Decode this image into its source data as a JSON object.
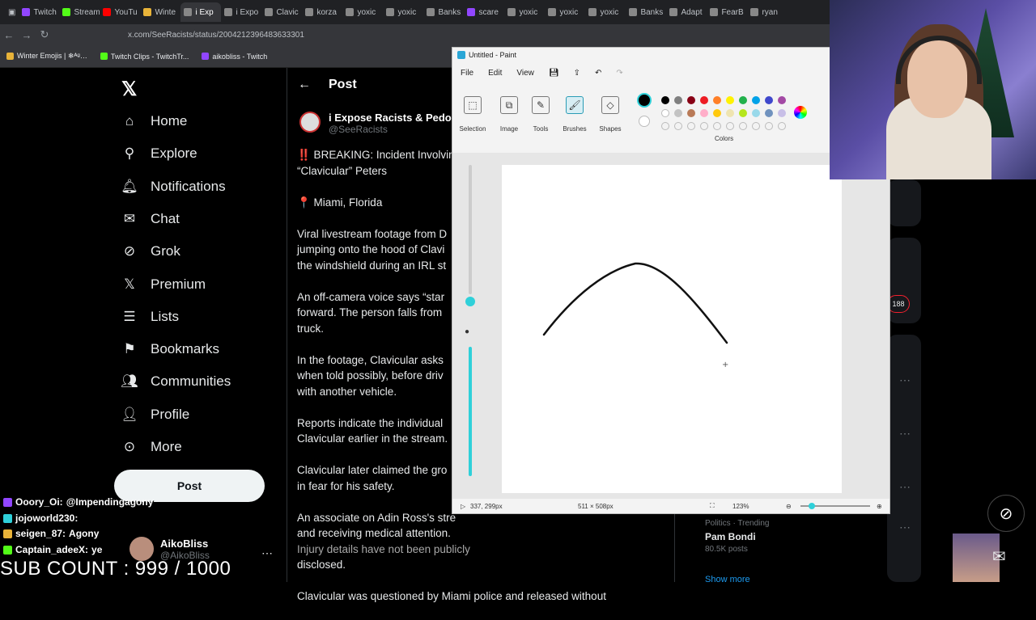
{
  "browser": {
    "tabs": [
      {
        "label": "Twitch",
        "color": "#9146ff"
      },
      {
        "label": "Stream",
        "color": "#53fc18"
      },
      {
        "label": "YouTu",
        "color": "#ff0000"
      },
      {
        "label": "Winte",
        "color": "#e8b339"
      },
      {
        "label": "i Exp",
        "color": "#888888",
        "active": true
      },
      {
        "label": "i Expo",
        "color": "#888888"
      },
      {
        "label": "Clavic",
        "color": "#888888"
      },
      {
        "label": "korza",
        "color": "#888888"
      },
      {
        "label": "yoxic",
        "color": "#888888"
      },
      {
        "label": "yoxic",
        "color": "#888888"
      },
      {
        "label": "Banks",
        "color": "#888888"
      },
      {
        "label": "scare",
        "color": "#9146ff"
      },
      {
        "label": "yoxic",
        "color": "#888888"
      },
      {
        "label": "yoxic",
        "color": "#888888"
      },
      {
        "label": "yoxic",
        "color": "#888888"
      },
      {
        "label": "Banks",
        "color": "#888888"
      },
      {
        "label": "Adapt",
        "color": "#888888"
      },
      {
        "label": "FearB",
        "color": "#888888"
      },
      {
        "label": "ryan",
        "color": "#888888"
      }
    ],
    "url": "x.com/SeeRacists/status/2004212396483633301",
    "bookmarks": [
      {
        "label": "Winter Emojis | ❄ᴬᵍ…",
        "color": "#e8b339"
      },
      {
        "label": "Twitch Clips - TwitchTr...",
        "color": "#53fc18"
      },
      {
        "label": "aikobliss - Twitch",
        "color": "#9146ff"
      }
    ]
  },
  "x": {
    "logo": "𝕏",
    "nav": [
      {
        "label": "Home",
        "icon": "home-icon",
        "glyph": "⌂"
      },
      {
        "label": "Explore",
        "icon": "search-icon",
        "glyph": "⚲"
      },
      {
        "label": "Notifications",
        "icon": "bell-icon",
        "glyph": "🔔︎"
      },
      {
        "label": "Chat",
        "icon": "mail-icon",
        "glyph": "✉"
      },
      {
        "label": "Grok",
        "icon": "grok-icon",
        "glyph": "⊘"
      },
      {
        "label": "Premium",
        "icon": "x-icon",
        "glyph": "𝕏"
      },
      {
        "label": "Lists",
        "icon": "list-icon",
        "glyph": "☰"
      },
      {
        "label": "Bookmarks",
        "icon": "bookmark-icon",
        "glyph": "⚑"
      },
      {
        "label": "Communities",
        "icon": "people-icon",
        "glyph": "👥︎"
      },
      {
        "label": "Profile",
        "icon": "person-icon",
        "glyph": "👤︎"
      },
      {
        "label": "More",
        "icon": "more-icon",
        "glyph": "⊙"
      }
    ],
    "post_button": "Post",
    "account": {
      "name": "AikoBliss",
      "handle": "@AikoBliss"
    },
    "post_header": "Post",
    "author": {
      "name": "i Expose Racists & Pedos",
      "handle": "@SeeRacists"
    },
    "tweet": [
      "‼️ BREAKING: Incident Involvin",
      "“Clavicular” Peters",
      "📍 Miami, Florida",
      "Viral livestream footage from D",
      "jumping onto the hood of Clavi",
      "the windshield during an IRL st",
      "An off-camera voice says “star",
      "forward. The person falls from",
      "truck.",
      "In the footage, Clavicular asks",
      "when told possibly, before driv",
      "with another vehicle.",
      "Reports indicate the individual",
      "Clavicular earlier in the stream.",
      "Clavicular later claimed the gro",
      "in fear for his safety.",
      "An associate on Adin Ross's stre",
      "and receiving medical attention.",
      "Injury details have not been publicly",
      "disclosed.",
      "Clavicular was questioned by Miami police and released without"
    ],
    "trend": {
      "category": "Politics · Trending",
      "name": "Pam Bondi",
      "count": "80.5K posts"
    },
    "show_more": "Show more",
    "badge_count": "188"
  },
  "paint": {
    "title": "Untitled - Paint",
    "menu": [
      "File",
      "Edit",
      "View"
    ],
    "groups": [
      "Selection",
      "Image",
      "Tools",
      "Brushes",
      "Shapes",
      "Colors"
    ],
    "status": {
      "cursor": "337, 299px",
      "size": "511 × 508px",
      "zoom": "123%"
    },
    "colors_row1": [
      "#000000",
      "#7f7f7f",
      "#880015",
      "#ed1c24",
      "#ff7f27",
      "#fff200",
      "#22b14c",
      "#00a2e8",
      "#3f48cc",
      "#a349a4"
    ],
    "colors_row2": [
      "#ffffff",
      "#c3c3c3",
      "#b97a57",
      "#ffaec9",
      "#ffc90e",
      "#efe4b0",
      "#b5e61d",
      "#99d9ea",
      "#7092be",
      "#c8bfe7"
    ]
  },
  "chat": [
    {
      "user": "Ooory_Oi:",
      "msg": "@Impendingagony",
      "color": "#ffffff"
    },
    {
      "user": "jojoworld230:",
      "msg": "",
      "color": "#ffffff"
    },
    {
      "user": "seigen_87:",
      "msg": "Agony",
      "color": "#ffffff"
    },
    {
      "user": "Captain_adeeX:",
      "msg": "ye",
      "color": "#ffffff"
    }
  ],
  "sub_count": "SUB COUNT : 999 / 1000"
}
